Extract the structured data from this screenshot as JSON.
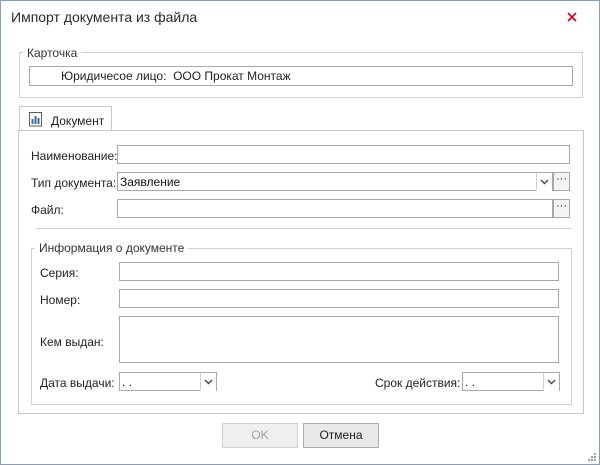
{
  "window": {
    "title": "Импорт документа из файла"
  },
  "card": {
    "legend": "Карточка",
    "entity": "Юридичесое лицо:  ООО Прокат Монтаж"
  },
  "tab": {
    "label": "Документ"
  },
  "form": {
    "name_label": "Наименование:",
    "name_value": "",
    "doctype_label": "Тип документа:",
    "doctype_value": "Заявление",
    "file_label": "Файл:",
    "file_value": "",
    "ellipsis": "···"
  },
  "info": {
    "legend": "Информация о документе",
    "series_label": "Серия:",
    "series_value": "",
    "number_label": "Номер:",
    "number_value": "",
    "issuer_label": "Кем выдан:",
    "issuer_value": "",
    "issue_date_label": "Дата выдачи:",
    "issue_date_value": " .  .",
    "validity_label": "Срок действия:",
    "validity_value": " .  ."
  },
  "buttons": {
    "ok": "OK",
    "cancel": "Отмена"
  },
  "colors": {
    "accent_close": "#d0021b",
    "tab_icon": "#3a6ea5"
  }
}
